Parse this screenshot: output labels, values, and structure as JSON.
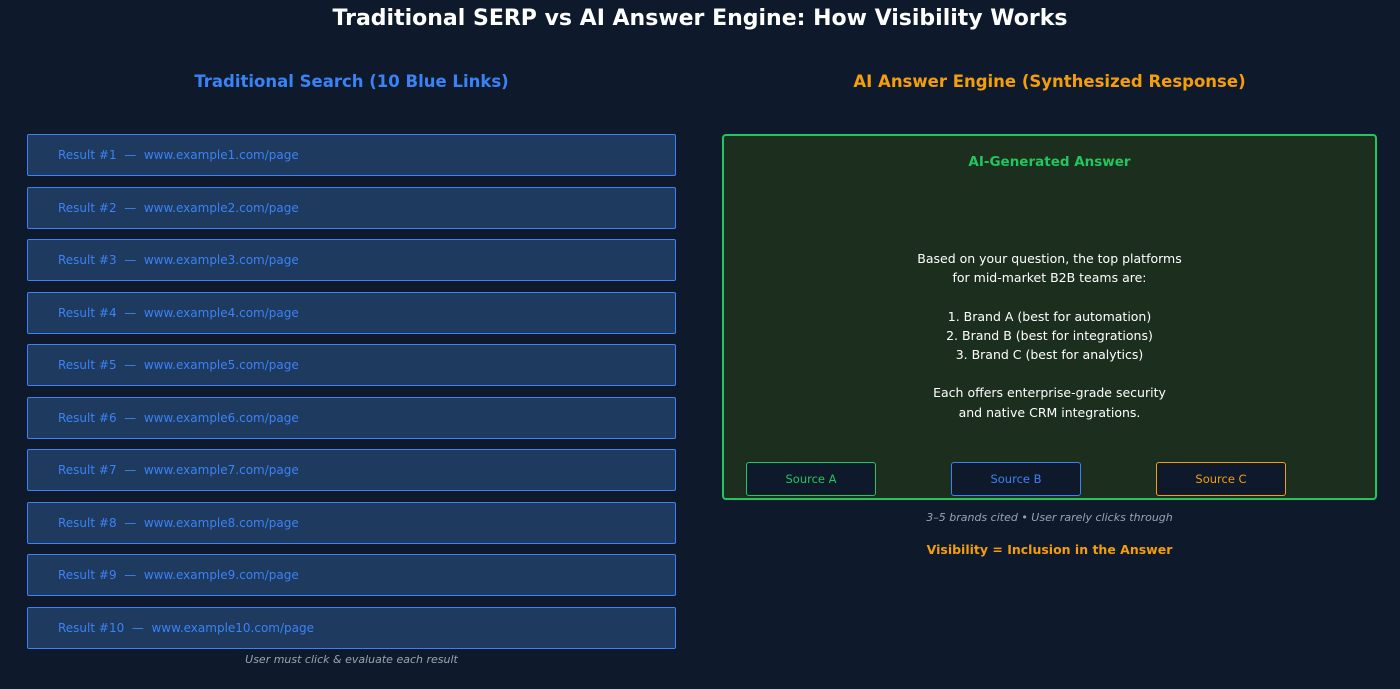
{
  "title": "Traditional SERP vs AI Answer Engine: How Visibility Works",
  "colors": {
    "background": "#0e1a2b",
    "blue": "#3b82f6",
    "orange": "#f59e0b",
    "green": "#22c55e",
    "caption": "#9ca3af"
  },
  "left": {
    "title": "Traditional Search (10 Blue Links)",
    "results": [
      "Result #1  —  www.example1.com/page",
      "Result #2  —  www.example2.com/page",
      "Result #3  —  www.example3.com/page",
      "Result #4  —  www.example4.com/page",
      "Result #5  —  www.example5.com/page",
      "Result #6  —  www.example6.com/page",
      "Result #7  —  www.example7.com/page",
      "Result #8  —  www.example8.com/page",
      "Result #9  —  www.example9.com/page",
      "Result #10  —  www.example10.com/page"
    ],
    "caption": "User must click & evaluate each result"
  },
  "right": {
    "title": "AI Answer Engine (Synthesized Response)",
    "answer_heading": "AI-Generated Answer",
    "answer_lines": [
      "Based on your question, the top platforms",
      "for mid-market B2B teams are:",
      "",
      "1.  Brand A  (best for automation)",
      "2.  Brand B  (best for integrations)",
      "3.  Brand C  (best for analytics)",
      "",
      "Each offers enterprise-grade security",
      "and native CRM integrations."
    ],
    "sources": [
      "Source A",
      "Source B",
      "Source C"
    ],
    "caption": "3–5 brands cited  •  User rarely clicks through",
    "visibility": "Visibility = Inclusion in the Answer"
  }
}
